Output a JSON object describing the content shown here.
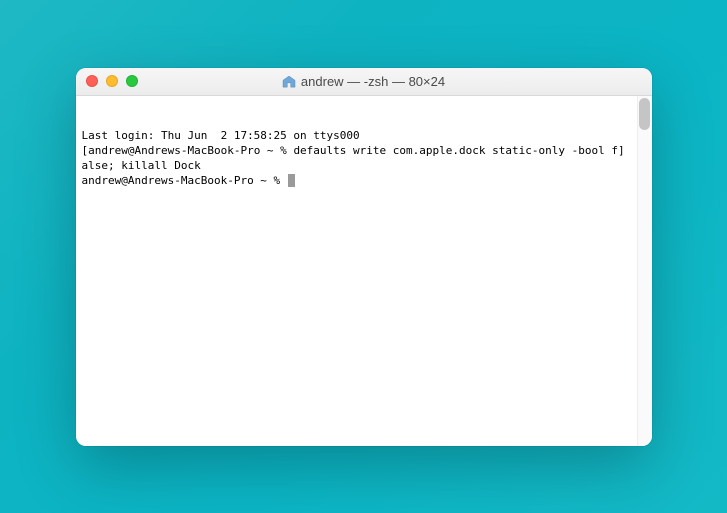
{
  "window": {
    "title": "andrew — -zsh — 80×24"
  },
  "terminal": {
    "line1": "Last login: Thu Jun  2 17:58:25 on ttys000",
    "line2_prefix": "[",
    "line2_prompt": "andrew@Andrews-MacBook-Pro ~ % ",
    "line2_command": "defaults write com.apple.dock static-only -bool f",
    "line2_suffix": "]",
    "line3": "alse; killall Dock",
    "line4_prompt": "andrew@Andrews-MacBook-Pro ~ % "
  }
}
